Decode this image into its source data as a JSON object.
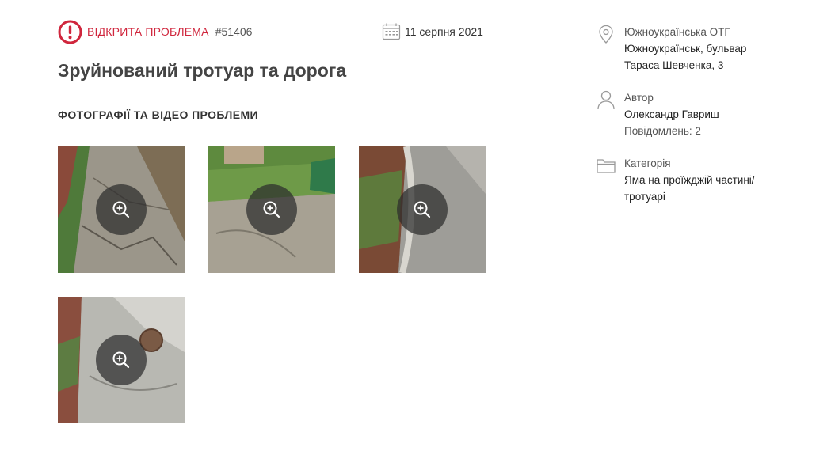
{
  "problem": {
    "status": "ВІДКРИТА ПРОБЛЕМА",
    "id": "#51406",
    "date": "11 серпня 2021",
    "title": "Зруйнований тротуар та дорога"
  },
  "media": {
    "section_title": "ФОТОГРАФІЇ ТА ВІДЕО ПРОБЛЕМИ",
    "photos": [
      {
        "icon": "zoom-in-icon"
      },
      {
        "icon": "zoom-in-icon"
      },
      {
        "icon": "zoom-in-icon"
      },
      {
        "icon": "zoom-in-icon"
      }
    ]
  },
  "sidebar": {
    "location": {
      "icon": "map-pin-icon",
      "community": "Южноукраїнська ОТГ",
      "address_line1": "Южноукраїнськ, бульвар",
      "address_line2": "Тараса Шевченка, 3"
    },
    "author": {
      "icon": "user-icon",
      "label": "Автор",
      "name": "Олександр Гавриш",
      "messages": "Повідомлень: 2"
    },
    "category": {
      "icon": "folder-icon",
      "label": "Категорія",
      "line1": "Яма на проїжджій частині/",
      "line2": "тротуарі"
    }
  },
  "colors": {
    "accent": "#d0263d",
    "text": "#3d3d3d",
    "overlay": "#2d2d2d"
  }
}
